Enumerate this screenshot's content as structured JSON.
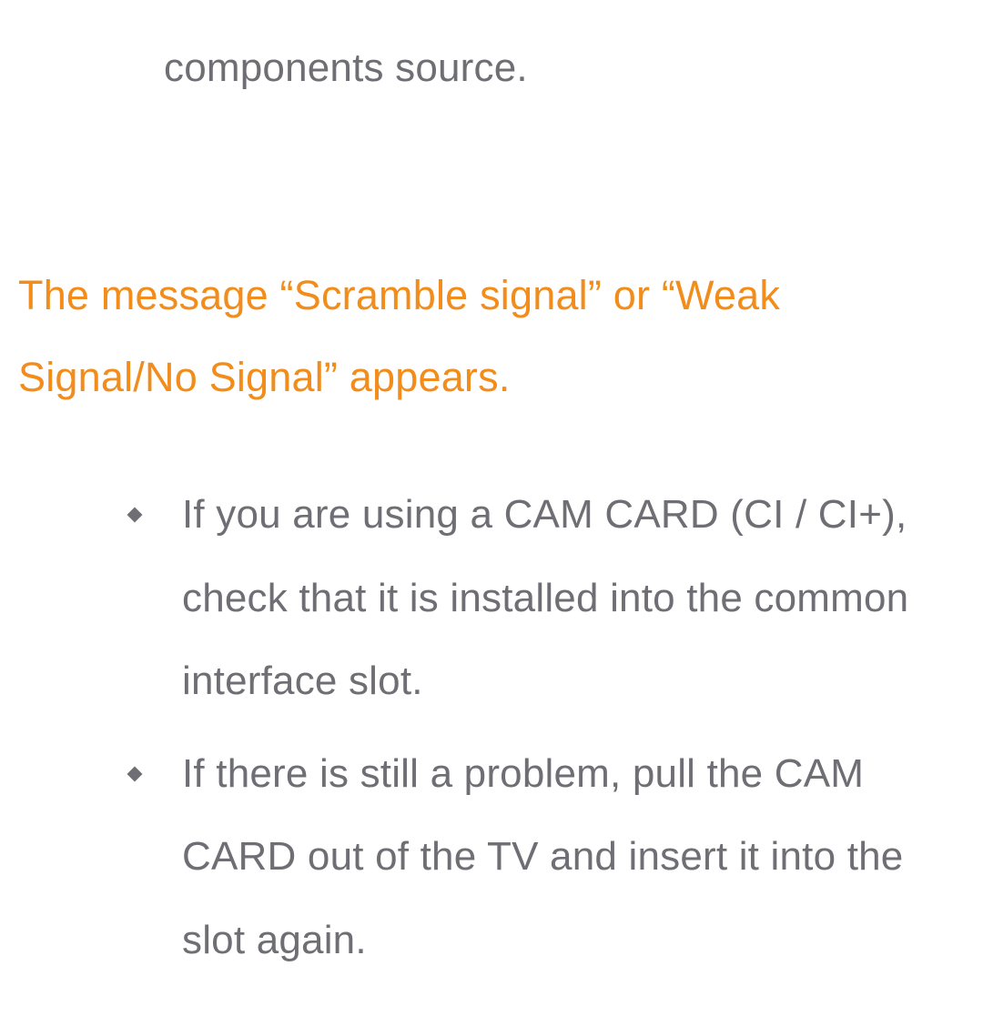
{
  "fragment_line": "components source.",
  "heading": "The message “Scramble signal” or “Weak Signal/No Signal” appears.",
  "bullets": [
    "If you are using a CAM CARD (CI / CI+), check that it is installed into the common interface slot.",
    "If there is still a problem, pull the CAM CARD out of the TV and insert it into the slot again."
  ]
}
